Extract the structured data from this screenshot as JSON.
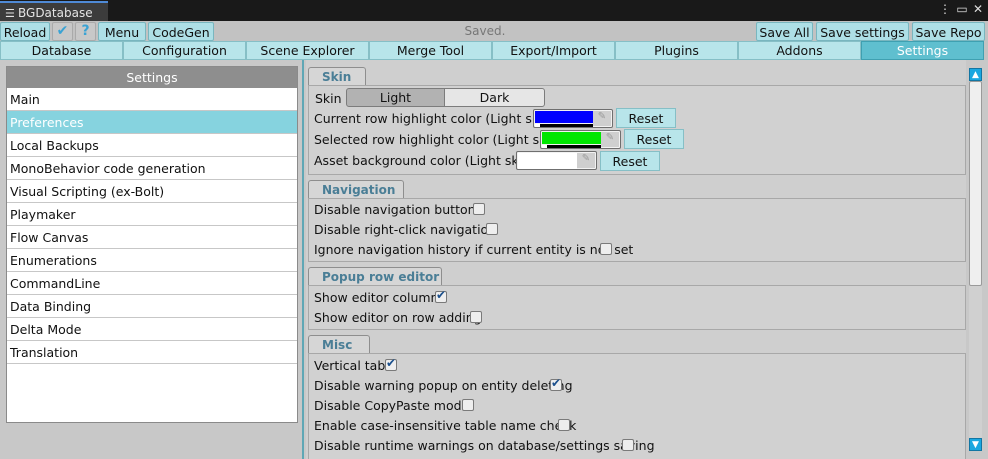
{
  "window": {
    "title": "BGDatabase",
    "controls": [
      "⋮",
      "▭",
      "✕"
    ]
  },
  "toolbar": {
    "reload": "Reload",
    "menu": "Menu",
    "codegen": "CodeGen",
    "status": "Saved.",
    "save_all": "Save All",
    "save_settings": "Save settings",
    "save_repo": "Save Repo"
  },
  "tabs": [
    "Database",
    "Configuration",
    "Scene Explorer",
    "Merge Tool",
    "Export/Import",
    "Plugins",
    "Addons",
    "Settings"
  ],
  "active_tab": "Settings",
  "sidebar": {
    "header": "Settings",
    "items": [
      "Main",
      "Preferences",
      "Local Backups",
      "MonoBehavior code generation",
      "Visual Scripting (ex-Bolt)",
      "Playmaker",
      "Flow Canvas",
      "Enumerations",
      "CommandLine",
      "Data Binding",
      "Delta Mode",
      "Translation"
    ],
    "selected": "Preferences"
  },
  "skin": {
    "section": "Skin",
    "label": "Skin",
    "options": [
      "Light",
      "Dark"
    ],
    "selected": "Light",
    "current_row_label": "Current row highlight color (Light skin)",
    "current_row_color": "#0000ff",
    "selected_row_label": "Selected row highlight color (Light skin)",
    "selected_row_color": "#00e600",
    "asset_bg_label": "Asset background color (Light skin)",
    "asset_bg_color": "#ffffff",
    "reset": "Reset"
  },
  "navigation": {
    "section": "Navigation",
    "items": [
      {
        "label": "Disable navigation buttons",
        "checked": false
      },
      {
        "label": "Disable right-click navigation",
        "checked": false
      },
      {
        "label": "Ignore navigation history if current entity is not set",
        "checked": false
      }
    ]
  },
  "popup": {
    "section": "Popup row editor",
    "items": [
      {
        "label": "Show editor column",
        "checked": true
      },
      {
        "label": "Show editor on row adding",
        "checked": false
      }
    ]
  },
  "misc": {
    "section": "Misc",
    "items": [
      {
        "label": "Vertical tab",
        "checked": true
      },
      {
        "label": "Disable warning popup on entity deleting",
        "checked": true
      },
      {
        "label": "Disable CopyPaste mode",
        "checked": false
      },
      {
        "label": "Enable case-insensitive table name check",
        "checked": false
      },
      {
        "label": "Disable runtime warnings on database/settings saving",
        "checked": false
      }
    ]
  },
  "scrollbar": {
    "up": "▲",
    "down": "▼"
  }
}
